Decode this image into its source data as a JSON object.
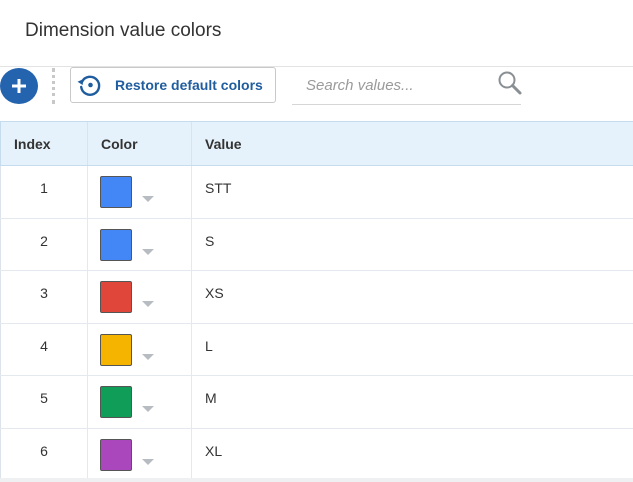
{
  "page": {
    "title": "Dimension value colors"
  },
  "toolbar": {
    "add_icon": "plus-icon",
    "restore_icon": "restore-icon",
    "restore_label": "Restore default colors",
    "search_placeholder": "Search values...",
    "search_value": "",
    "search_icon": "search-icon"
  },
  "table": {
    "headers": {
      "index": "Index",
      "color": "Color",
      "value": "Value"
    },
    "rows": [
      {
        "index": "1",
        "color": "#4287f5",
        "value": "STT"
      },
      {
        "index": "2",
        "color": "#4287f5",
        "value": "S"
      },
      {
        "index": "3",
        "color": "#e0463a",
        "value": "XS"
      },
      {
        "index": "4",
        "color": "#f4b400",
        "value": "L"
      },
      {
        "index": "5",
        "color": "#0f9d58",
        "value": "M"
      },
      {
        "index": "6",
        "color": "#ab47bc",
        "value": "XL"
      }
    ]
  },
  "colors": {
    "accent": "#2463ae",
    "link_text": "#1f5d9f",
    "header_bg": "#e5f1fb"
  }
}
